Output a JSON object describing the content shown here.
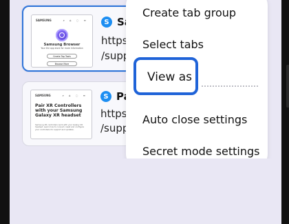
{
  "tabs": [
    {
      "title": "Samsu",
      "url_line_1": "https://w",
      "url_line_2": "/support",
      "preview": {
        "brand": "SAMSUNG",
        "icons": "⌕ ⌂ ◌ ≡",
        "title": "Samsung Browser",
        "subtitle": "Your the app store for more information",
        "button_1": "Create Top Tools",
        "button_2": "Browse More"
      }
    },
    {
      "title": "Pair X",
      "url_line_1": "https://w",
      "url_line_2": "/support",
      "preview": {
        "brand": "SAMSUNG",
        "icons": "⌕ ⌂ ◌ ≡",
        "title": "Pair XR Controllers with your Samsung Galaxy XR headset",
        "copy": "Samsung XR controllers work with your Galaxy XR headset. Learn how to connect, reset and configure your controllers for support and updates."
      }
    }
  ],
  "menu": {
    "create_tab_group": "Create tab group",
    "select_tabs": "Select tabs",
    "view_as": "View as",
    "auto_close_settings": "Auto close settings",
    "secret_mode_settings": "Secret mode settings"
  },
  "colors": {
    "selection_blue": "#2f74d8",
    "menu_highlight_blue": "#1f63d8",
    "site_icon_blue": "#1d8ef2"
  }
}
